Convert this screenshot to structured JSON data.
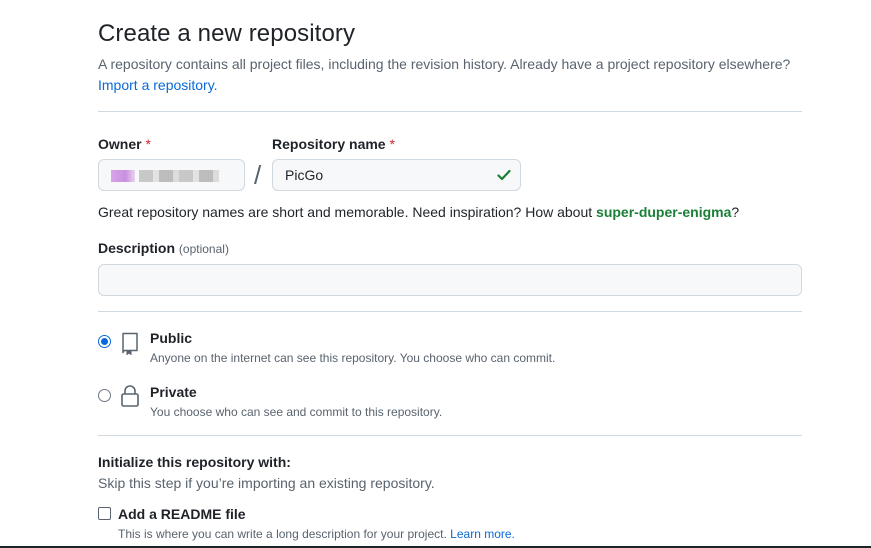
{
  "header": {
    "title": "Create a new repository",
    "description": "A repository contains all project files, including the revision history. Already have a project repository elsewhere?",
    "import_link": "Import a repository."
  },
  "owner": {
    "label": "Owner",
    "required_mark": "*"
  },
  "repo_name": {
    "label": "Repository name",
    "required_mark": "*",
    "separator": "/",
    "value": "PicGo",
    "status_icon": "check-icon",
    "status_color": "#1a7f37"
  },
  "hint": {
    "text": "Great repository names are short and memorable. Need inspiration? How about ",
    "suggestion": "super-duper-enigma",
    "suffix": "?"
  },
  "description": {
    "label": "Description",
    "optional": "(optional)",
    "value": ""
  },
  "visibility": {
    "public": {
      "title": "Public",
      "subtitle": "Anyone on the internet can see this repository. You choose who can commit.",
      "selected": true,
      "icon": "repo-icon"
    },
    "private": {
      "title": "Private",
      "subtitle": "You choose who can see and commit to this repository.",
      "selected": false,
      "icon": "lock-icon"
    }
  },
  "initialize": {
    "title": "Initialize this repository with:",
    "subtitle": "Skip this step if you’re importing an existing repository.",
    "readme": {
      "title": "Add a README file",
      "subtitle": "This is where you can write a long description for your project.",
      "learn_more": "Learn more.",
      "checked": false
    }
  },
  "colors": {
    "accent": "#0969da",
    "success": "#1a7f37",
    "danger": "#d1242f"
  }
}
